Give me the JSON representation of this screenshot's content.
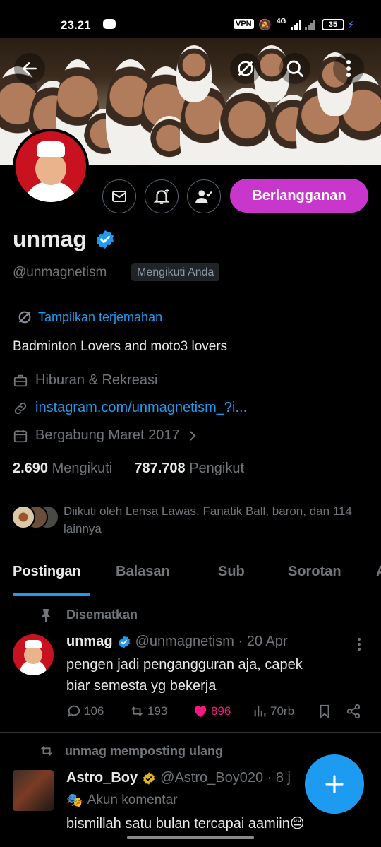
{
  "status_bar": {
    "time": "23.21",
    "vpn": "VPN",
    "network": "4G",
    "battery": "35"
  },
  "profile": {
    "name": "unmag",
    "handle": "@unmagnetism",
    "follows_you": "Mengikuti Anda",
    "translate": "Tampilkan terjemahan",
    "bio": "Badminton Lovers and moto3 lovers",
    "category": "Hiburan & Rekreasi",
    "link": "instagram.com/unmagnetism_?i...",
    "joined": "Bergabung Maret 2017",
    "following_count": "2.690",
    "following_label": "Mengikuti",
    "followers_count": "787.708",
    "followers_label": "Pengikut",
    "followed_by": "Diikuti oleh Lensa Lawas, Fanatik Ball, baron, dan 114 lainnya",
    "subscribe_label": "Berlangganan"
  },
  "tabs": [
    "Postingan",
    "Balasan",
    "Sub",
    "Sorotan",
    "A"
  ],
  "pinned_post": {
    "context": "Disematkan",
    "name": "unmag",
    "handle_time": "@unmagnetism · 20 Apr",
    "text_line1": "pengen jadi pengangguran aja, capek",
    "text_line2": "biar semesta yg bekerja",
    "replies": "106",
    "reposts": "193",
    "likes": "896",
    "views": "70rb"
  },
  "repost": {
    "context": "unmag memposting ulang",
    "name": "Astro_Boy",
    "handle_time": "@Astro_Boy020 · 8 j",
    "label": "Akun komentar",
    "text": "bismillah satu bulan tercapai aamiin"
  },
  "colors": {
    "accent": "#1d9bf0",
    "subscribe": "#c936cc",
    "like": "#f91880",
    "gold": "#e2b719"
  }
}
